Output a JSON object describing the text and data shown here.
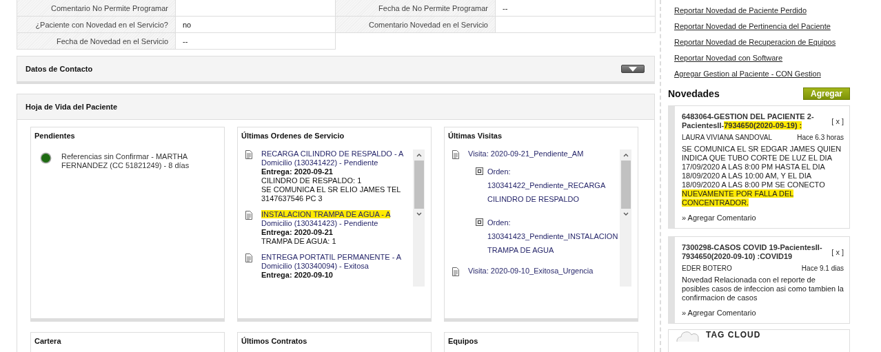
{
  "patient_fields": [
    {
      "label": "Comentario No Permite Programar"
    },
    {
      "label": "Fecha de No Permite Programar",
      "value": "--"
    },
    {
      "label": "¿Paciente con Novedad en el Servicio?",
      "value": "no"
    },
    {
      "label": "Comentario Novedad en el Servicio"
    },
    {
      "label": "Fecha de Novedad en el Servicio",
      "value": "--"
    }
  ],
  "contact_panel": {
    "title": "Datos de Contacto",
    "expanded": false
  },
  "history_panel": {
    "title": "Hoja de Vida del Paciente",
    "pending": {
      "title": "Pendientes",
      "items": [
        {
          "text": "Referencias sin Confirmar - MARTHA FERNANDEZ (CC 51821249) - 8 días",
          "color": "#1e6b12"
        }
      ]
    },
    "orders": {
      "title": "Últimas Ordenes de Servicio",
      "items": [
        {
          "title": [
            {
              "text": "RECARGA CILINDRO DE RESPALDO - A",
              "highlighted": false
            },
            {
              "text": " Domicilio (130341422) - Pendiente",
              "highlighted": false
            }
          ],
          "delivery": "Entrega: 2020-09-21",
          "details": [
            "CILINDRO DE RESPALDO: 1",
            "SE COMUNICA EL SR ELIO JAMES TEL 3147637546 PC 3"
          ]
        },
        {
          "title": [
            {
              "text": "INSTALACION TRAMPA DE AGUA - A",
              "highlighted": true
            },
            {
              "text": " Domicilio (130341423) - Pendiente",
              "highlighted": false
            }
          ],
          "delivery": "Entrega: 2020-09-21",
          "details": [
            "TRAMPA DE AGUA: 1"
          ]
        },
        {
          "title": [
            {
              "text": "ENTREGA PORTATIL PERMANENTE - A",
              "highlighted": false
            },
            {
              "text": " Domicilio (130340094) - Exitosa",
              "highlighted": false
            }
          ],
          "delivery": "Entrega: 2020-09-10"
        }
      ]
    },
    "visits": {
      "title": "Últimas Visitas",
      "items": [
        {
          "text": "Visita: 2020-09-21_Pendiente_AM",
          "children": [
            {
              "text": "Orden: 130341422_Pendiente_RECARGA CILINDRO DE RESPALDO"
            },
            {
              "text": "Orden: 130341423_Pendiente_INSTALACION TRAMPA DE AGUA"
            }
          ]
        },
        {
          "text": "Visita: 2020-09-10_Exitosa_Urgencia"
        }
      ]
    },
    "lower_boxes": [
      "Cartera",
      "Últimos Contratos",
      "Equipos"
    ]
  },
  "sidebar": {
    "links": [
      "Reportar Novedad de Paciente Perdido",
      "Reportar Novedad de Pertinencia del Paciente",
      "Reportar Novedad de Recuperacion de Equipos",
      "Reportar Novedad con Software",
      "Agregar Gestion al Paciente - CON Gestion"
    ],
    "novedades": {
      "title": "Novedades",
      "add_button": "Agregar",
      "items": [
        {
          "title": [
            {
              "text": "6483064-GESTION DEL PACIENTE 2-PacientesII-",
              "highlighted": false
            },
            {
              "text": "7934650(2020-09-19) :",
              "highlighted": true
            }
          ],
          "close_label": "[ x ]",
          "comment_link": "» Agregar Comentario",
          "author": "LAURA VIVIANA SANDOVAL",
          "time": "Hace 6.3 horas",
          "body": [
            {
              "text": "SE COMUNICA EL SR EDGAR JAMES QUIEN INDICA QUE TUBO CORTE DE LUZ EL DIA 17/09/2020 A LAS 8:00 PM HASTA EL DIA 18/09/2020 A LAS 10:00 AM, Y EL DIA 18/09/2020 A LAS 8:00 PM SE CONECTO ",
              "highlighted": false
            },
            {
              "text": "NUEVAMENTE POR FALLA DEL CONCENTRADOR.",
              "highlighted": true
            }
          ]
        },
        {
          "title": [
            {
              "text": "7300298-CASOS COVID 19-PacientesII-7934650(2020-09-10) :COVID19",
              "highlighted": false
            }
          ],
          "close_label": "[ x ]",
          "comment_link": "» Agregar Comentario",
          "author": "EDER BOTERO",
          "time": "Hace 9.1 dias",
          "body": [
            {
              "text": "Novedad Relacionada con el reporte de posibles casos de infeccion asi como tambien la confirmacion de casos",
              "highlighted": false
            }
          ]
        }
      ]
    },
    "tag_cloud": {
      "title": "TAG CLOUD"
    }
  }
}
